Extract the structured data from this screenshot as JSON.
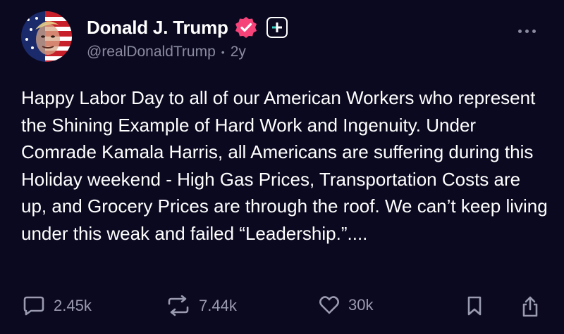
{
  "author": {
    "name": "Donald J. Trump",
    "handle": "@realDonaldTrump",
    "time": "2y",
    "separator": "•"
  },
  "post": {
    "text": "Happy Labor Day to all of our American Workers who represent the Shining Example of Hard Work and Ingenuity. Under Comrade Kamala Harris, all Americans are suffering during this Holiday weekend - High Gas Prices, Transportation Costs are up, and Grocery Prices are through the roof. We can’t keep living under this weak and failed “Leadership.”...."
  },
  "stats": {
    "replies": "2.45k",
    "reposts": "7.44k",
    "likes": "30k"
  },
  "colors": {
    "background": "#0b0920",
    "verified_badge": "#f5437a",
    "muted_text": "#8b8ba0"
  },
  "icons": [
    "avatar",
    "verified-badge-icon",
    "plus-icon",
    "more-icon",
    "reply-icon",
    "repost-icon",
    "like-icon",
    "bookmark-icon",
    "share-icon"
  ]
}
